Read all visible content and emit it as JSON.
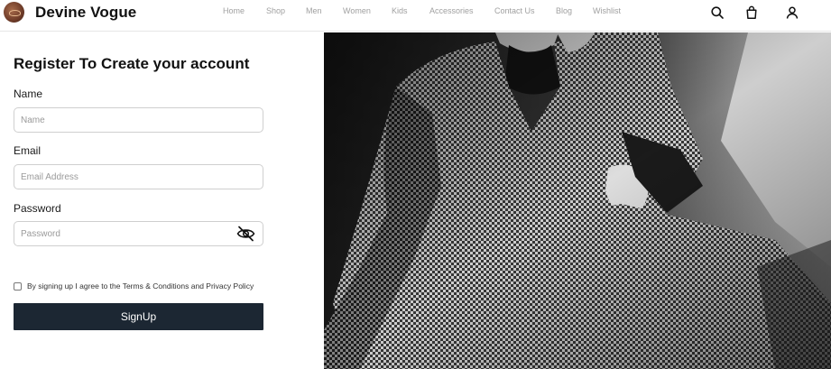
{
  "header": {
    "brand": "Devine Vogue",
    "nav": [
      "Home",
      "Shop",
      "Men",
      "Women",
      "Kids",
      "Accessories",
      "Contact Us",
      "Blog",
      "Wishlist"
    ],
    "icons": [
      "search-icon",
      "shopping-bag-icon",
      "user-icon"
    ]
  },
  "form": {
    "title": "Register To Create your account",
    "name_label": "Name",
    "name_placeholder": "Name",
    "email_label": "Email",
    "email_placeholder": "Email Address",
    "password_label": "Password",
    "password_placeholder": "Password",
    "password_toggle_icon": "eye-off-icon",
    "agree_text": "By signing up I agree to the Terms & Conditions and Privacy Policy",
    "submit_label": "SignUp"
  },
  "colors": {
    "button_bg": "#1c2733",
    "nav_text": "#a0a0a0"
  }
}
